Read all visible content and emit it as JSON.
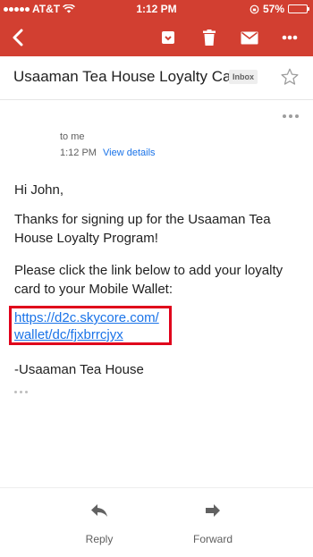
{
  "status_bar": {
    "carrier": "AT&T",
    "time": "1:12 PM",
    "battery": "57%",
    "battery_level": 0.57
  },
  "toolbar": {
    "icons": [
      "back-arrow-icon",
      "move-to-folder-icon",
      "trash-icon",
      "mark-unread-icon",
      "more-vert-icon"
    ]
  },
  "email": {
    "subject": "Usaaman Tea House Loyalty Card",
    "label": "Inbox",
    "to": "to me",
    "time": "1:12 PM",
    "view_details": "View details",
    "greeting": "Hi John,",
    "paragraph1": "Thanks for signing up for the Usaaman Tea House Loyalty Program!",
    "paragraph2": "Please click the link below to add your loyalty  card to your Mobile Wallet:",
    "link_line1": "https://d2c.skycore.com/",
    "link_line2": "wallet/dc/fjxbrrcjyx",
    "signature": "-Usaaman Tea House"
  },
  "actions": {
    "reply": "Reply",
    "forward": "Forward"
  },
  "colors": {
    "header": "#d23f31",
    "link": "#1a73e8",
    "highlight_box": "#e0001b"
  }
}
